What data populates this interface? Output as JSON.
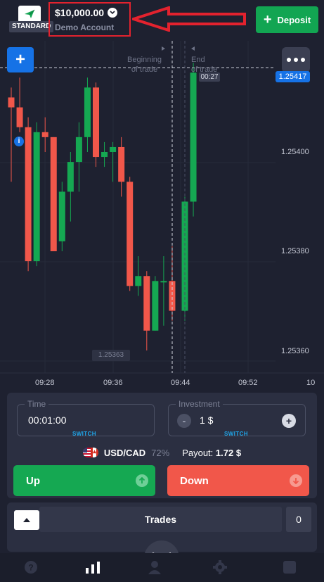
{
  "header": {
    "account_tier": "STANDARD",
    "balance": "$10,000.00",
    "account_type": "Demo Account",
    "deposit_label": "Deposit"
  },
  "chart": {
    "current_price": "1.25417",
    "timer": "00:27",
    "low_price": "1.25363",
    "beginning_label_1": "Beginning",
    "beginning_label_2": "of trade",
    "end_label_1": "End",
    "end_label_2": "of trade",
    "info_glyph": "i",
    "price_labels": [
      "1.25400",
      "1.25380",
      "1.25360"
    ],
    "time_labels": [
      "09:28",
      "09:36",
      "09:44",
      "09:52",
      "10"
    ]
  },
  "chart_data": {
    "type": "candlestick",
    "series": [
      {
        "open": 1.25411,
        "high": 1.25413,
        "low": 1.25394,
        "close": 1.25409
      },
      {
        "open": 1.25409,
        "high": 1.25415,
        "low": 1.25404,
        "close": 1.25405
      },
      {
        "open": 1.25405,
        "high": 1.25407,
        "low": 1.25376,
        "close": 1.25378
      },
      {
        "open": 1.25378,
        "high": 1.25406,
        "low": 1.25377,
        "close": 1.25404
      },
      {
        "open": 1.25404,
        "high": 1.25407,
        "low": 1.254,
        "close": 1.25403
      },
      {
        "open": 1.25403,
        "high": 1.25403,
        "low": 1.2538,
        "close": 1.2538
      },
      {
        "open": 1.25382,
        "high": 1.25394,
        "low": 1.2538,
        "close": 1.25392
      },
      {
        "open": 1.25392,
        "high": 1.254,
        "low": 1.25386,
        "close": 1.25398
      },
      {
        "open": 1.25398,
        "high": 1.25406,
        "low": 1.25392,
        "close": 1.25403
      },
      {
        "open": 1.25403,
        "high": 1.25415,
        "low": 1.254,
        "close": 1.25413
      },
      {
        "open": 1.25413,
        "high": 1.25414,
        "low": 1.25397,
        "close": 1.25399
      },
      {
        "open": 1.25399,
        "high": 1.25402,
        "low": 1.25397,
        "close": 1.254
      },
      {
        "open": 1.254,
        "high": 1.25402,
        "low": 1.25394,
        "close": 1.25401
      },
      {
        "open": 1.25401,
        "high": 1.25403,
        "low": 1.25391,
        "close": 1.25394
      },
      {
        "open": 1.25394,
        "high": 1.25395,
        "low": 1.25372,
        "close": 1.25373
      },
      {
        "open": 1.25373,
        "high": 1.25379,
        "low": 1.25371,
        "close": 1.25375
      },
      {
        "open": 1.25375,
        "high": 1.25376,
        "low": 1.2536,
        "close": 1.25364
      },
      {
        "open": 1.25364,
        "high": 1.25375,
        "low": 1.25364,
        "close": 1.25374
      },
      {
        "open": 1.25374,
        "high": 1.25379,
        "low": 1.25365,
        "close": 1.25374
      },
      {
        "open": 1.25374,
        "high": 1.25381,
        "low": 1.25366,
        "close": 1.25368
      },
      {
        "open": 1.25368,
        "high": 1.25391,
        "low": 1.25366,
        "close": 1.2539
      },
      {
        "open": 1.2539,
        "high": 1.25418,
        "low": 1.25387,
        "close": 1.25416
      }
    ],
    "y_ticks": [
      1.254,
      1.2538,
      1.2536
    ],
    "x_ticks": [
      "09:28",
      "09:36",
      "09:44",
      "09:52",
      "10"
    ]
  },
  "panel": {
    "time_label": "Time",
    "time_value": "00:01:00",
    "time_switch": "SWITCH",
    "investment_label": "Investment",
    "investment_value": "1 $",
    "investment_switch": "SWITCH",
    "minus": "-",
    "plus": "+",
    "pair": "USD/CAD",
    "pair_percent": "72%",
    "payout_label": "Payout:",
    "payout_value": "1.72 $",
    "up_label": "Up",
    "down_label": "Down"
  },
  "trades": {
    "title": "Trades",
    "count": "0"
  },
  "colors": {
    "background": "#1e2130",
    "up_green": "#15a852",
    "down_red": "#f1574a",
    "accent_blue": "#1672e6",
    "annotation_red": "#e3222e"
  },
  "icons": {
    "logo": "paper-plane-icon",
    "caret": "chevron-down-icon",
    "nav": [
      "help-icon",
      "chart-bars-icon",
      "user-icon",
      "gear-icon",
      "square-icon"
    ]
  }
}
